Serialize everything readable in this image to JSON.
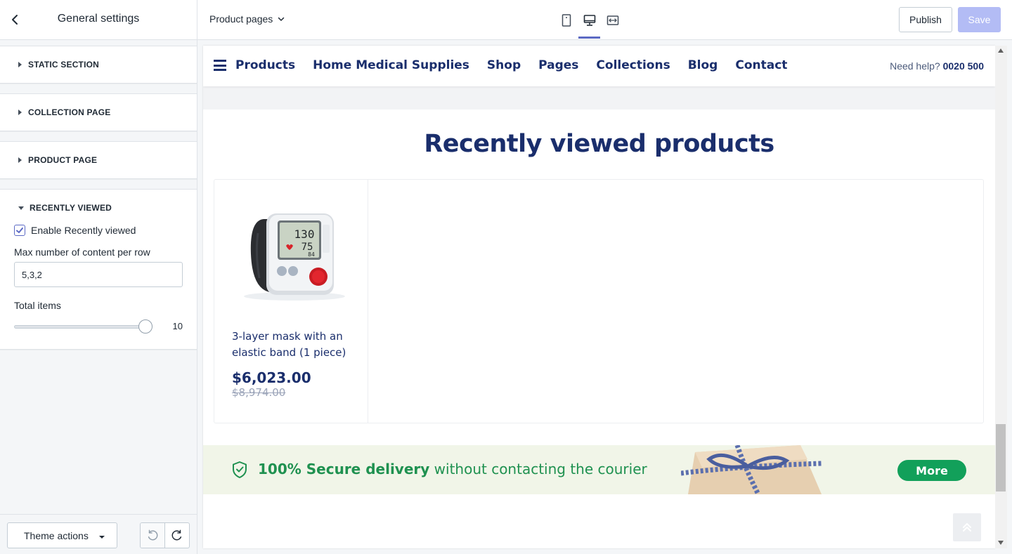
{
  "sidebar": {
    "title": "General settings",
    "sections": [
      {
        "label": "STATIC SECTION"
      },
      {
        "label": "COLLECTION PAGE"
      },
      {
        "label": "PRODUCT PAGE"
      },
      {
        "label": "RECENTLY VIEWED"
      }
    ],
    "recently_viewed": {
      "enable_label": "Enable Recently viewed",
      "enabled": true,
      "max_label": "Max number of content per row",
      "max_value": "5,3,2",
      "total_label": "Total items",
      "total_value": "10"
    },
    "footer": {
      "theme_actions_label": "Theme actions"
    }
  },
  "topbar": {
    "page_selector": "Product pages",
    "active_device": "desktop",
    "publish_label": "Publish",
    "save_label": "Save"
  },
  "preview": {
    "nav": {
      "links": [
        "Products",
        "Home Medical Supplies",
        "Shop",
        "Pages",
        "Collections",
        "Blog",
        "Contact"
      ],
      "help_prefix": "Need help?",
      "help_phone": "0020 500"
    },
    "section_title": "Recently viewed products",
    "products": [
      {
        "name": "3-layer mask with an elastic band (1 piece)",
        "price": "$6,023.00",
        "compare_price": "$8,974.00"
      }
    ],
    "promo": {
      "bold": "100% Secure delivery",
      "rest": " without contacting the courier",
      "button": "More"
    }
  },
  "colors": {
    "accent": "#5c6ac4",
    "brand_navy": "#1a2e6c",
    "promo_green": "#12a05a"
  }
}
